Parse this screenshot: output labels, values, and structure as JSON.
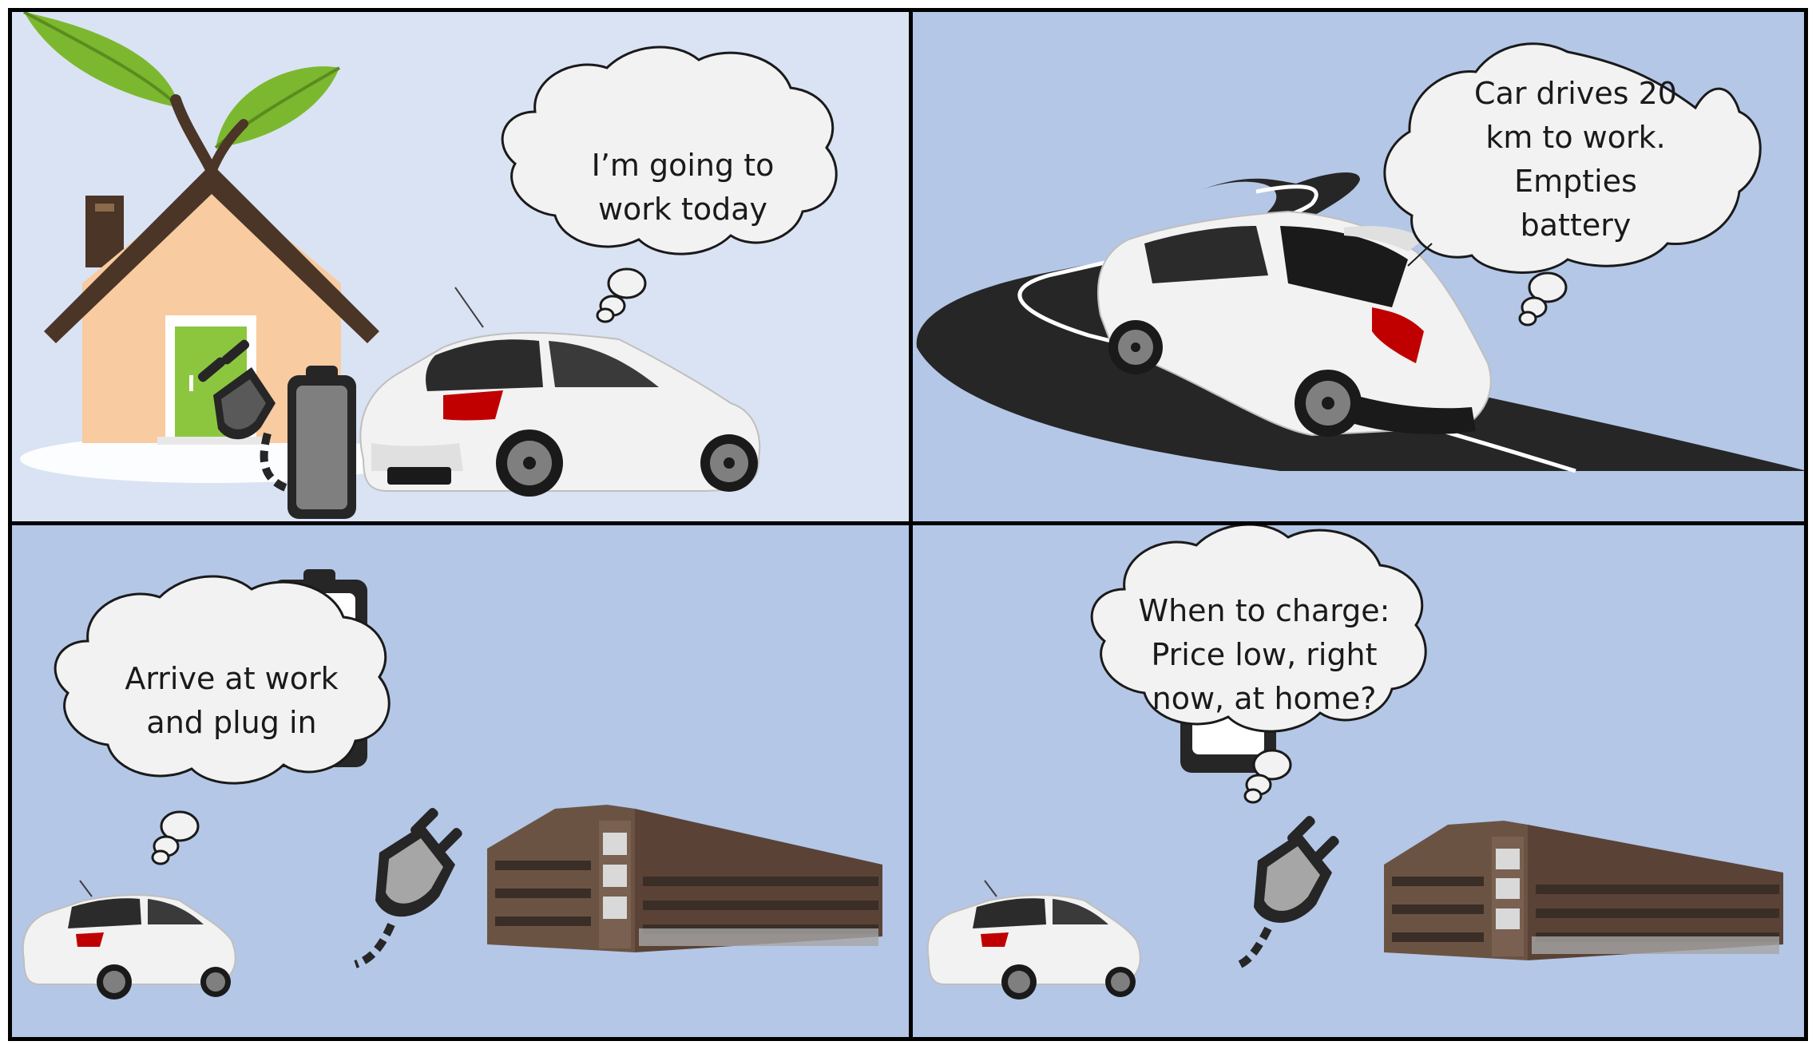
{
  "panels": [
    {
      "id": "panel-1",
      "thought": [
        "I’m going to",
        "work today"
      ]
    },
    {
      "id": "panel-2",
      "thought": [
        "Car drives 20",
        "km to work.",
        "Empties",
        "battery"
      ]
    },
    {
      "id": "panel-3",
      "thought": [
        "Arrive at work",
        "and plug in"
      ]
    },
    {
      "id": "panel-4",
      "thought": [
        "When to charge:",
        "Price low, right",
        "now, at home?"
      ]
    }
  ],
  "colors": {
    "sky_light": "#dae3f3",
    "sky_blue": "#b4c7e7",
    "house_wall": "#f8cba0",
    "door_green": "#8cc63f",
    "roof_brown": "#4a3526",
    "leaf_green": "#7cb82f",
    "car_white": "#f2f2f2",
    "road_dark": "#262626",
    "brick": "#6b5344",
    "battery_gray": "#7f7f7f"
  },
  "icons": [
    "plant-leaves-icon",
    "house-icon",
    "plug-icon",
    "battery-icon",
    "car-icon",
    "road-icon",
    "office-building-icon",
    "thought-bubble-icon"
  ]
}
